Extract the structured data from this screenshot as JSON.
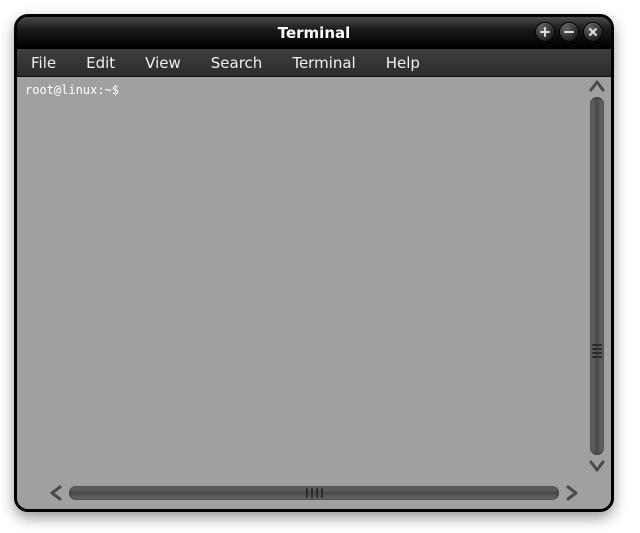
{
  "window": {
    "title": "Terminal"
  },
  "menubar": {
    "items": [
      {
        "label": "File"
      },
      {
        "label": "Edit"
      },
      {
        "label": "View"
      },
      {
        "label": "Search"
      },
      {
        "label": "Terminal"
      },
      {
        "label": "Help"
      }
    ]
  },
  "terminal": {
    "prompt": "root@linux:~$"
  }
}
